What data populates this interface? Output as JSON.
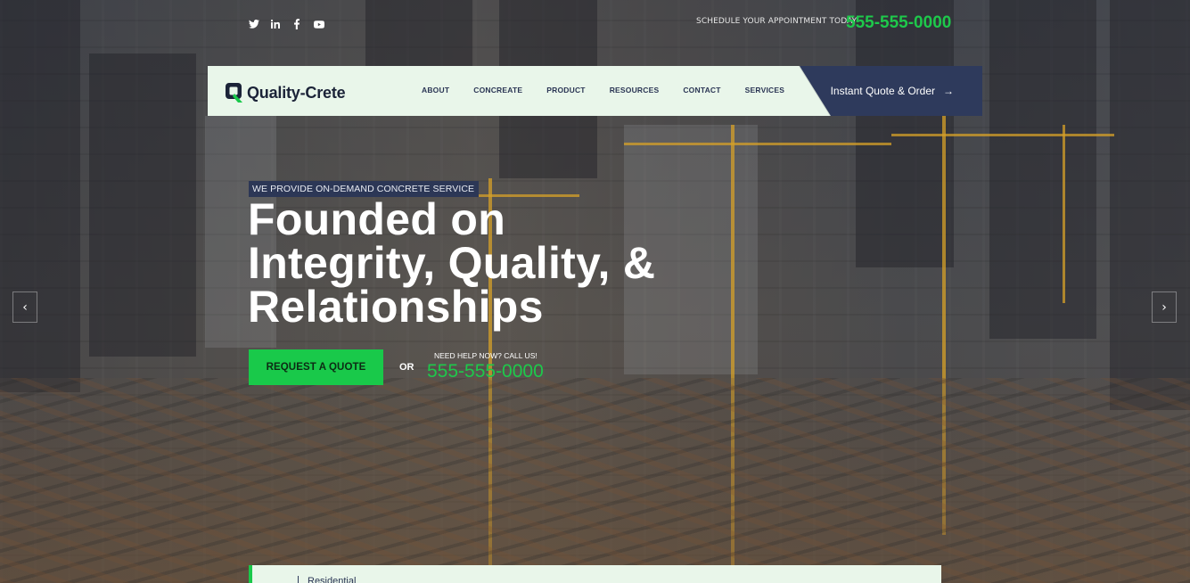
{
  "topbar": {
    "social": [
      "twitter-icon",
      "linkedin-icon",
      "facebook-icon",
      "youtube-icon"
    ],
    "appointment_text": "SCHEDULE YOUR APPOINTMENT TODAY",
    "phone": "555-555-0000"
  },
  "header": {
    "logo_text": "Quality-Crete",
    "nav": [
      "ABOUT",
      "CONCREATE",
      "PRODUCT",
      "RESOURCES",
      "CONTACT",
      "SERVICES"
    ],
    "cta_label": "Instant Quote & Order",
    "cta_arrow": "→"
  },
  "hero": {
    "tagline": "WE PROVIDE ON-DEMAND CONCRETE SERVICE",
    "headline_lines": [
      "Founded on",
      "Integrity, Quality, &",
      "Relationships"
    ],
    "request_button": "REQUEST A QUOTE",
    "or_text": "OR",
    "help_text": "NEED HELP NOW? CALL US!",
    "phone": "555-555-0000"
  },
  "slider": {
    "prev": "‹",
    "next": "›"
  },
  "bottom_card": {
    "label": "Residential"
  },
  "colors": {
    "accent_green": "#19c94a",
    "navy": "#2e3a5c",
    "nav_bg": "#e9f6ea"
  }
}
